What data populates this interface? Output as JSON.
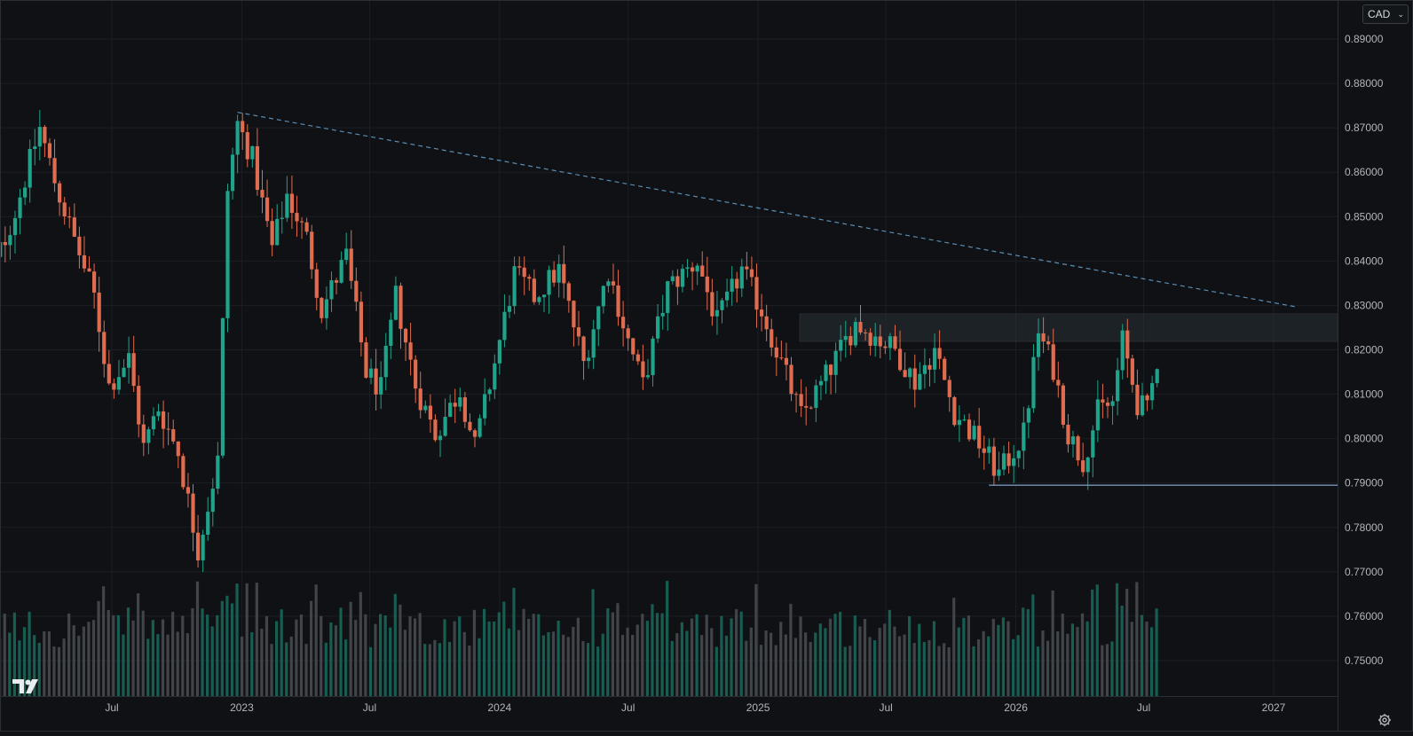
{
  "currency_selector": {
    "value": "CAD"
  },
  "icons": {
    "settings": "gear-icon",
    "logo": "tradingview-logo",
    "dropdown": "chevron-down-icon"
  },
  "colors": {
    "background": "#0f1114",
    "up": "#1fa38a",
    "down": "#e06c4f",
    "volume_up": "#1a6b5d",
    "volume_down": "#4a4d52",
    "trendline": "#5b8fb6",
    "support": "#7a94b8",
    "grid": "#1b1f24",
    "axis_text": "#b2b5bb",
    "zone": "#2a3138"
  },
  "chart_data": {
    "type": "candlestick",
    "interval": "weekly",
    "currency": "CAD",
    "y_axis": {
      "ylim": [
        0.742,
        0.894
      ],
      "tick_labels": [
        "0.89000",
        "0.88000",
        "0.87000",
        "0.86000",
        "0.85000",
        "0.84000",
        "0.83000",
        "0.82000",
        "0.81000",
        "0.80000",
        "0.79000",
        "0.78000",
        "0.77000",
        "0.76000",
        "0.75000"
      ]
    },
    "x_axis": {
      "tick_labels": [
        "Jul",
        "2023",
        "Jul",
        "2024",
        "Jul",
        "2025",
        "Jul",
        "2026",
        "Jul",
        "2027"
      ],
      "tick_dates": [
        "2022-07",
        "2023-01",
        "2023-07",
        "2024-01",
        "2024-07",
        "2025-01",
        "2025-07",
        "2026-01",
        "2026-07",
        "2027-01"
      ],
      "range": [
        "2022-01",
        "2027-03"
      ]
    },
    "annotations": {
      "descending_trendline": {
        "from": {
          "date": "2022-12-26",
          "price": 0.8735
        },
        "to": {
          "date": "2027-02",
          "price": 0.8297
        },
        "style": "dashed"
      },
      "resistance_zone": {
        "from_date": "2025-03",
        "price_low": 0.8219,
        "price_high": 0.8281
      },
      "support_line": {
        "from_date": "2025-11-24",
        "price": 0.7895
      }
    },
    "anchors": [
      {
        "date": "2022-01-03",
        "price": 0.834
      },
      {
        "date": "2022-02-14",
        "price": 0.851
      },
      {
        "date": "2022-03-21",
        "price": 0.87
      },
      {
        "date": "2022-04-11",
        "price": 0.858
      },
      {
        "date": "2022-05-02",
        "price": 0.848
      },
      {
        "date": "2022-06-06",
        "price": 0.832
      },
      {
        "date": "2022-06-27",
        "price": 0.812
      },
      {
        "date": "2022-07-25",
        "price": 0.818
      },
      {
        "date": "2022-08-15",
        "price": 0.798
      },
      {
        "date": "2022-09-05",
        "price": 0.807
      },
      {
        "date": "2022-10-03",
        "price": 0.797
      },
      {
        "date": "2022-10-31",
        "price": 0.775
      },
      {
        "date": "2022-11-28",
        "price": 0.795
      },
      {
        "date": "2022-12-12",
        "price": 0.856
      },
      {
        "date": "2022-12-26",
        "price": 0.871
      },
      {
        "date": "2023-01-16",
        "price": 0.863
      },
      {
        "date": "2023-02-13",
        "price": 0.843
      },
      {
        "date": "2023-03-06",
        "price": 0.855
      },
      {
        "date": "2023-04-03",
        "price": 0.845
      },
      {
        "date": "2023-04-24",
        "price": 0.829
      },
      {
        "date": "2023-05-29",
        "price": 0.841
      },
      {
        "date": "2023-06-26",
        "price": 0.815
      },
      {
        "date": "2023-07-17",
        "price": 0.811
      },
      {
        "date": "2023-08-07",
        "price": 0.832
      },
      {
        "date": "2023-09-04",
        "price": 0.812
      },
      {
        "date": "2023-10-02",
        "price": 0.801
      },
      {
        "date": "2023-11-06",
        "price": 0.811
      },
      {
        "date": "2023-11-27",
        "price": 0.798
      },
      {
        "date": "2023-12-25",
        "price": 0.817
      },
      {
        "date": "2024-01-22",
        "price": 0.837
      },
      {
        "date": "2024-02-19",
        "price": 0.832
      },
      {
        "date": "2024-03-25",
        "price": 0.838
      },
      {
        "date": "2024-04-29",
        "price": 0.817
      },
      {
        "date": "2024-06-03",
        "price": 0.838
      },
      {
        "date": "2024-07-01",
        "price": 0.822
      },
      {
        "date": "2024-07-22",
        "price": 0.812
      },
      {
        "date": "2024-08-26",
        "price": 0.834
      },
      {
        "date": "2024-10-07",
        "price": 0.84
      },
      {
        "date": "2024-11-04",
        "price": 0.826
      },
      {
        "date": "2024-12-09",
        "price": 0.838
      },
      {
        "date": "2025-01-06",
        "price": 0.829
      },
      {
        "date": "2025-02-03",
        "price": 0.817
      },
      {
        "date": "2025-03-03",
        "price": 0.805
      },
      {
        "date": "2025-03-31",
        "price": 0.812
      },
      {
        "date": "2025-04-21",
        "price": 0.818
      },
      {
        "date": "2025-05-19",
        "price": 0.826
      },
      {
        "date": "2025-06-16",
        "price": 0.823
      },
      {
        "date": "2025-07-14",
        "price": 0.82
      },
      {
        "date": "2025-08-11",
        "price": 0.813
      },
      {
        "date": "2025-09-08",
        "price": 0.82
      },
      {
        "date": "2025-10-06",
        "price": 0.806
      },
      {
        "date": "2025-11-10",
        "price": 0.799
      },
      {
        "date": "2025-12-08",
        "price": 0.792
      },
      {
        "date": "2026-01-12",
        "price": 0.801
      },
      {
        "date": "2026-02-02",
        "price": 0.824
      },
      {
        "date": "2026-02-23",
        "price": 0.816
      },
      {
        "date": "2026-03-16",
        "price": 0.801
      },
      {
        "date": "2026-04-06",
        "price": 0.795
      },
      {
        "date": "2026-04-27",
        "price": 0.806
      },
      {
        "date": "2026-05-18",
        "price": 0.808
      },
      {
        "date": "2026-06-01",
        "price": 0.822
      },
      {
        "date": "2026-06-22",
        "price": 0.808
      },
      {
        "date": "2026-07-06",
        "price": 0.806
      },
      {
        "date": "2026-07-20",
        "price": 0.818
      }
    ]
  }
}
